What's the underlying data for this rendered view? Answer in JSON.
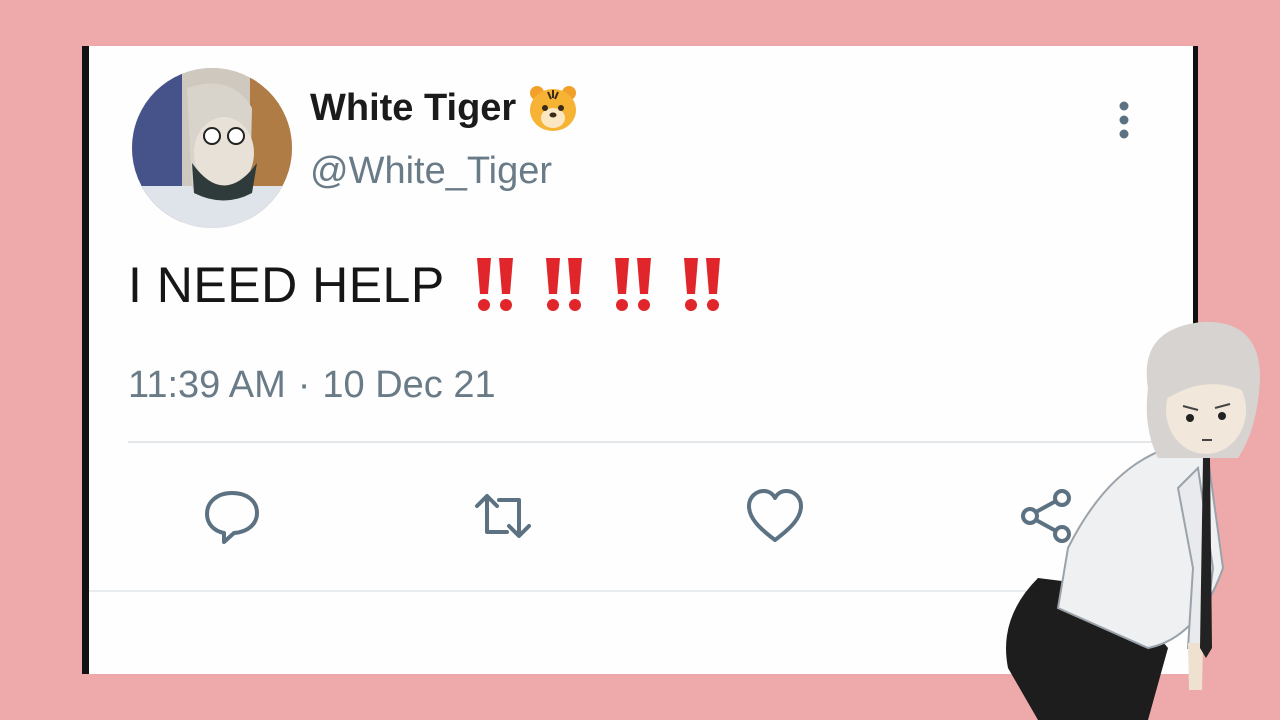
{
  "tweet": {
    "author": {
      "display_name": "White Tiger",
      "name_emoji": "tiger-face-emoji",
      "handle": "@White_Tiger"
    },
    "text": "I NEED HELP",
    "text_emoji": "double-exclamation-emoji",
    "time": "11:39 AM",
    "separator": "·",
    "date": "10 Dec 21"
  },
  "actions": [
    "reply-icon",
    "retweet-icon",
    "like-icon",
    "share-icon"
  ],
  "colors": {
    "background": "#eeaaaa",
    "card": "#fdfefd",
    "text": "#161616",
    "muted": "#6a7b88",
    "icon": "#5c7181",
    "emoji_red": "#e0262b"
  }
}
